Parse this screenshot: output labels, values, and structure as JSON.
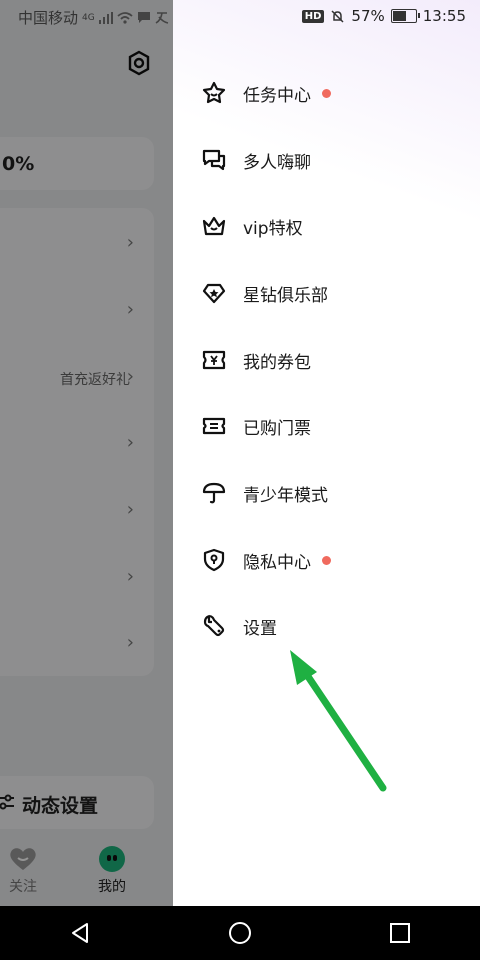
{
  "status_bar": {
    "carrier": "中国移动",
    "network": "4G",
    "battery_percent": "57%",
    "battery_level": 0.57,
    "time": "13:55",
    "hd_label": "HD"
  },
  "background": {
    "stat_fragment": "0%",
    "promo_text": "首充返好礼",
    "dynamic_settings": "动态设置",
    "tabs": {
      "follow": "关注",
      "mine": "我的"
    }
  },
  "drawer": {
    "items": [
      {
        "label": "任务中心",
        "icon": "star-badge-icon",
        "badge": true
      },
      {
        "label": "多人嗨聊",
        "icon": "chat-bubbles-icon",
        "badge": false
      },
      {
        "label": "vip特权",
        "icon": "crown-icon",
        "badge": false
      },
      {
        "label": "星钻俱乐部",
        "icon": "diamond-icon",
        "badge": false
      },
      {
        "label": "我的券包",
        "icon": "coupon-icon",
        "badge": false
      },
      {
        "label": "已购门票",
        "icon": "ticket-icon",
        "badge": false
      },
      {
        "label": "青少年模式",
        "icon": "umbrella-icon",
        "badge": false
      },
      {
        "label": "隐私中心",
        "icon": "shield-icon",
        "badge": true
      },
      {
        "label": "设置",
        "icon": "wrench-icon",
        "badge": false
      }
    ]
  },
  "colors": {
    "badge": "#f06a5e",
    "arrow": "#1fb042",
    "accent_green": "#1db27a"
  }
}
